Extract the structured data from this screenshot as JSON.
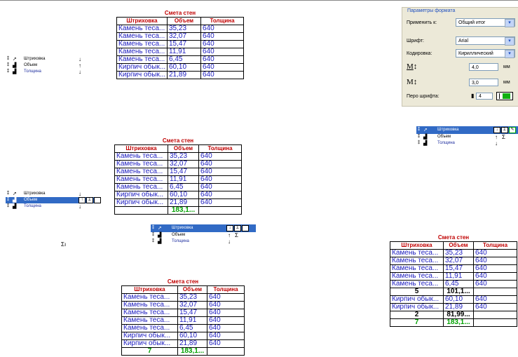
{
  "table": {
    "title": "Смета стен",
    "columns": [
      "Штриховка",
      "Объем",
      "Толщина"
    ],
    "rows": [
      [
        "Камень теса...",
        "35,23",
        "640"
      ],
      [
        "Камень теса...",
        "32,07",
        "640"
      ],
      [
        "Камень теса...",
        "15,47",
        "640"
      ],
      [
        "Камень теса...",
        "11,91",
        "640"
      ],
      [
        "Камень теса...",
        "6,45",
        "640"
      ],
      [
        "Кирпич обык...",
        "60,10",
        "640"
      ],
      [
        "Кирпич обык...",
        "21,89",
        "640"
      ]
    ],
    "total_volume": "183,1...",
    "total_count": "7",
    "group1_count": "5",
    "group1_volume": "101,1...",
    "group2_count": "2",
    "group2_volume": "81,99..."
  },
  "fields": {
    "f1": "Штриховка",
    "f2": "Объем",
    "f3": "Толщина"
  },
  "sigma": "Σ",
  "sigma_label": "Σı",
  "format_panel": {
    "title": "Параметры формата",
    "apply_label": "Применить к:",
    "apply_value": "Общий итог",
    "font_label": "Шрифт:",
    "font_value": "Arial",
    "encoding_label": "Кодировка:",
    "encoding_value": "Кириллический",
    "size1_value": "4,0",
    "size2_value": "3,0",
    "unit": "мм",
    "pen_label": "Перо шрифта:",
    "pen_value": "4"
  }
}
